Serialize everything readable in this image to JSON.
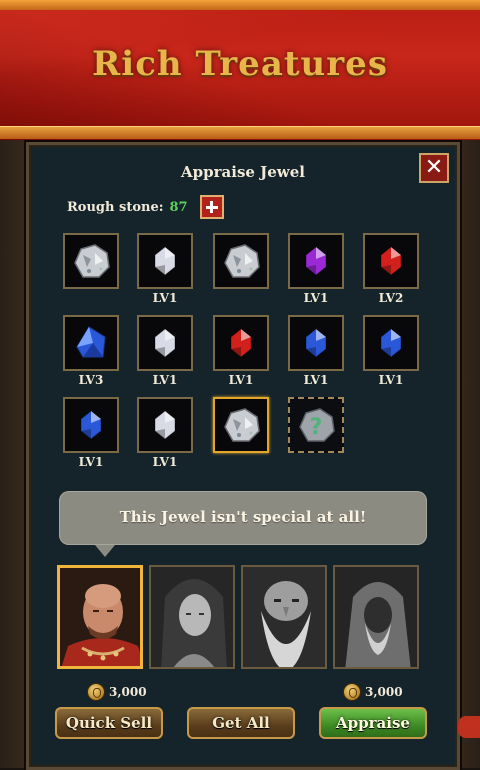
{
  "banner": {
    "title": "Rich Treatures"
  },
  "dialog": {
    "title": "Appraise Jewel",
    "close_icon": "close-icon",
    "rough_stone": {
      "label": "Rough stone:",
      "count": "87"
    }
  },
  "jewels": [
    {
      "icon": "rough-stone-icon",
      "color": "#c9ccd0",
      "level": ""
    },
    {
      "icon": "white-gem-icon",
      "color": "#d8dbe6",
      "level": "LV1"
    },
    {
      "icon": "rough-stone-icon",
      "color": "#c9ccd0",
      "level": ""
    },
    {
      "icon": "purple-gem-icon",
      "color": "#9b2ad6",
      "level": "LV1"
    },
    {
      "icon": "red-gem-icon",
      "color": "#d2201c",
      "level": "LV2"
    },
    {
      "icon": "blue-gem-icon",
      "color": "#2a58d8",
      "level": "LV3"
    },
    {
      "icon": "white-gem-icon",
      "color": "#d8dbe6",
      "level": "LV1"
    },
    {
      "icon": "red-gem-icon",
      "color": "#d2201c",
      "level": "LV1"
    },
    {
      "icon": "blue-gem-icon",
      "color": "#2a58d8",
      "level": "LV1"
    },
    {
      "icon": "blue-gem-icon",
      "color": "#2a58d8",
      "level": "LV1"
    },
    {
      "icon": "blue-gem-icon",
      "color": "#2a58d8",
      "level": "LV1"
    },
    {
      "icon": "white-gem-icon",
      "color": "#d8dbe6",
      "level": "LV1"
    },
    {
      "icon": "rough-stone-icon",
      "color": "#c9ccd0",
      "level": "",
      "selected": true
    },
    {
      "icon": "mystery-stone-icon",
      "color": "#4fb37a",
      "level": "",
      "mystery": true
    }
  ],
  "message": "This Jewel isn't special at all!",
  "appraisers": [
    {
      "name": "bald-merchant",
      "active": true
    },
    {
      "name": "long-haired-woman",
      "active": false
    },
    {
      "name": "bearded-dwarf",
      "active": false
    },
    {
      "name": "hooded-sage",
      "active": false
    }
  ],
  "costs": {
    "left": "3,000",
    "right": "3,000"
  },
  "buttons": {
    "quick_sell": "Quick Sell",
    "get_all": "Get All",
    "appraise": "Appraise"
  },
  "colors": {
    "accent_gold": "#e3a72c",
    "banner_red": "#c8261a",
    "panel_bg": "#15242a",
    "appraise_green": "#3e8a24"
  }
}
